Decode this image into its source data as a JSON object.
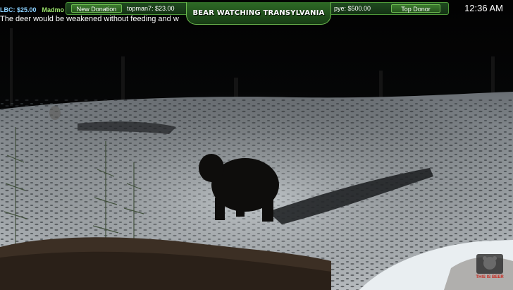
{
  "ticker": {
    "item1": "LBC: $25.00",
    "item2": "Madmo"
  },
  "donation_bar": {
    "new_donation_label": "New Donation",
    "new_donation_value": "topman7: $23.00",
    "top_donor_value": "pye: $500.00",
    "top_donor_label": "Top Donor"
  },
  "stream": {
    "title": "BEAR WATCHING TRANSYLVANIA",
    "clock": "12:36 AM",
    "caption": "The deer would be weakened without feeding and w"
  },
  "logo": {
    "text": "THIS IS BEER",
    "accent_color": "#c8281e"
  }
}
